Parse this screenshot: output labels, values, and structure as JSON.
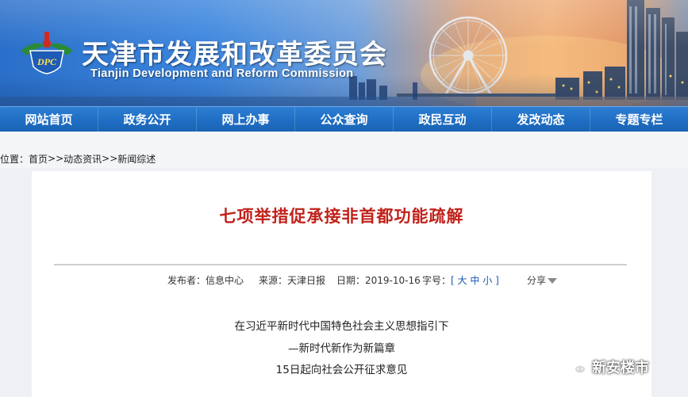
{
  "banner": {
    "title": "天津市发展和改革委员会",
    "subtitle": "Tianjin Development and Reform Commission",
    "logo_text": "DPC"
  },
  "nav": {
    "items": [
      {
        "label": "网站首页"
      },
      {
        "label": "政务公开"
      },
      {
        "label": "网上办事"
      },
      {
        "label": "公众查询"
      },
      {
        "label": "政民互动"
      },
      {
        "label": "发改动态"
      },
      {
        "label": "专题专栏"
      }
    ]
  },
  "breadcrumb": {
    "prefix": "位置：",
    "home": "首页",
    "sep1": ">>",
    "section": "动态资讯",
    "sep2": ">>",
    "current": "新闻综述"
  },
  "article": {
    "title": "七项举措促承接非首都功能疏解",
    "meta": {
      "publisher_label": "发布者：",
      "publisher": "信息中心",
      "source_label": "来源：",
      "source": "天津日报",
      "date_label": "日期：",
      "date": "2019-10-16",
      "font_label": "字号：",
      "font_open": "[",
      "font_large": "大",
      "font_medium": "中",
      "font_small": "小",
      "font_close": "]",
      "share_label": "分享"
    },
    "lines": [
      "在习近平新时代中国特色社会主义思想指引下",
      "—新时代新作为新篇章",
      "15日起向社会公开征求意见"
    ]
  },
  "watermark": {
    "text": "新安楼市",
    "icon": "wechat-icon"
  },
  "colors": {
    "nav_bg": "#1f6ec4",
    "title_red": "#c0221b",
    "link_blue": "#1a57b0"
  }
}
